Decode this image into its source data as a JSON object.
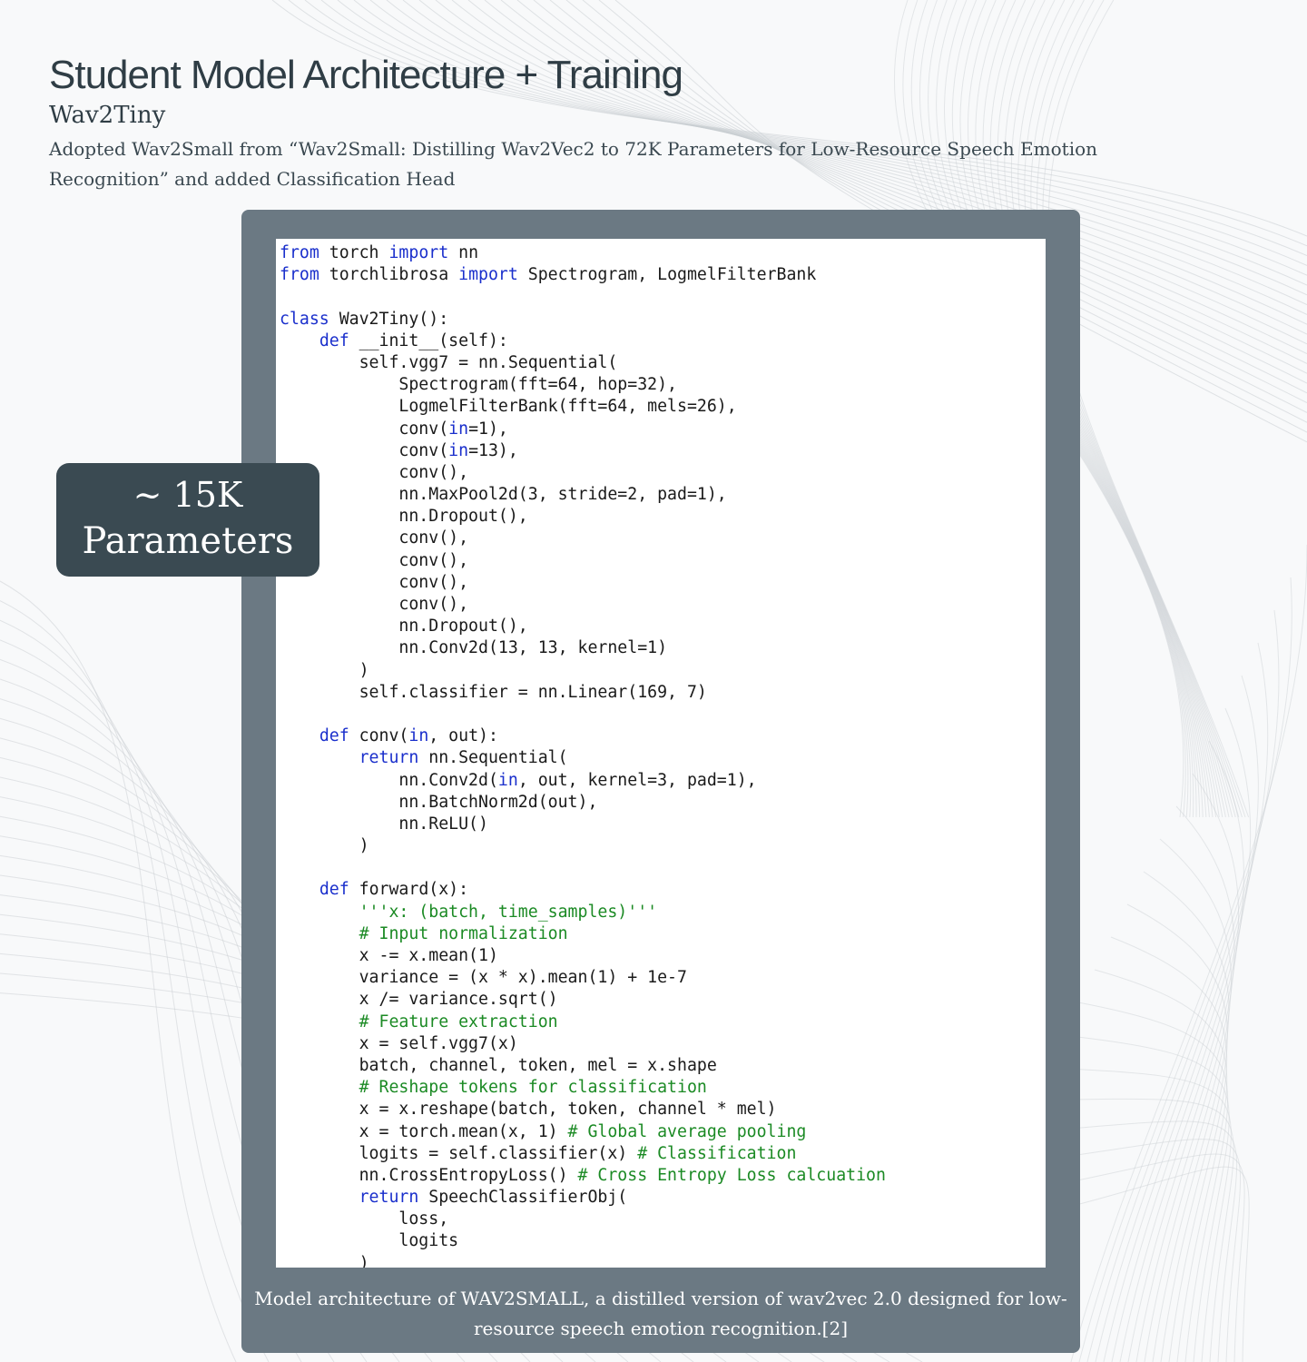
{
  "header": {
    "title": "Student Model Architecture + Training",
    "subtitle": "Wav2Tiny",
    "description": "Adopted Wav2Small from “Wav2Small: Distilling Wav2Vec2 to 72K Parameters for Low-Resource Speech Emotion Recognition” and added Classification Head"
  },
  "badge": {
    "line1": "~ 15K",
    "line2": "Parameters"
  },
  "code_figure": {
    "lines": [
      [
        [
          "kw",
          "from"
        ],
        [
          "t",
          " torch "
        ],
        [
          "kw",
          "import"
        ],
        [
          "t",
          " nn"
        ]
      ],
      [
        [
          "kw",
          "from"
        ],
        [
          "t",
          " torchlibrosa "
        ],
        [
          "kw",
          "import"
        ],
        [
          "t",
          " Spectrogram, LogmelFilterBank"
        ]
      ],
      [
        [
          "t",
          ""
        ]
      ],
      [
        [
          "kw",
          "class"
        ],
        [
          "t",
          " Wav2Tiny():"
        ]
      ],
      [
        [
          "t",
          "    "
        ],
        [
          "kw",
          "def"
        ],
        [
          "t",
          " __init__(self):"
        ]
      ],
      [
        [
          "t",
          "        self.vgg7 = nn.Sequential("
        ]
      ],
      [
        [
          "t",
          "            Spectrogram(fft=64, hop=32),"
        ]
      ],
      [
        [
          "t",
          "            LogmelFilterBank(fft=64, mels=26),"
        ]
      ],
      [
        [
          "t",
          "            conv("
        ],
        [
          "kw",
          "in"
        ],
        [
          "t",
          "=1),"
        ]
      ],
      [
        [
          "t",
          "            conv("
        ],
        [
          "kw",
          "in"
        ],
        [
          "t",
          "=13),"
        ]
      ],
      [
        [
          "t",
          "            conv(),"
        ]
      ],
      [
        [
          "t",
          "            nn.MaxPool2d(3, stride=2, pad=1),"
        ]
      ],
      [
        [
          "t",
          "            nn.Dropout(),"
        ]
      ],
      [
        [
          "t",
          "            conv(),"
        ]
      ],
      [
        [
          "t",
          "            conv(),"
        ]
      ],
      [
        [
          "t",
          "            conv(),"
        ]
      ],
      [
        [
          "t",
          "            conv(),"
        ]
      ],
      [
        [
          "t",
          "            nn.Dropout(),"
        ]
      ],
      [
        [
          "t",
          "            nn.Conv2d(13, 13, kernel=1)"
        ]
      ],
      [
        [
          "t",
          "        )"
        ]
      ],
      [
        [
          "t",
          "        self.classifier = nn.Linear(169, 7)"
        ]
      ],
      [
        [
          "t",
          ""
        ]
      ],
      [
        [
          "t",
          "    "
        ],
        [
          "kw",
          "def"
        ],
        [
          "t",
          " conv("
        ],
        [
          "kw",
          "in"
        ],
        [
          "t",
          ", out):"
        ]
      ],
      [
        [
          "t",
          "        "
        ],
        [
          "kw",
          "return"
        ],
        [
          "t",
          " nn.Sequential("
        ]
      ],
      [
        [
          "t",
          "            nn.Conv2d("
        ],
        [
          "kw",
          "in"
        ],
        [
          "t",
          ", out, kernel=3, pad=1),"
        ]
      ],
      [
        [
          "t",
          "            nn.BatchNorm2d(out),"
        ]
      ],
      [
        [
          "t",
          "            nn.ReLU()"
        ]
      ],
      [
        [
          "t",
          "        )"
        ]
      ],
      [
        [
          "t",
          ""
        ]
      ],
      [
        [
          "t",
          "    "
        ],
        [
          "kw",
          "def"
        ],
        [
          "t",
          " forward(x):"
        ]
      ],
      [
        [
          "t",
          "        "
        ],
        [
          "cm",
          "'''x: (batch, time_samples)'''"
        ]
      ],
      [
        [
          "t",
          "        "
        ],
        [
          "cm",
          "# Input normalization"
        ]
      ],
      [
        [
          "t",
          "        x -= x.mean(1)"
        ]
      ],
      [
        [
          "t",
          "        variance = (x * x).mean(1) + 1e-7"
        ]
      ],
      [
        [
          "t",
          "        x /= variance.sqrt()"
        ]
      ],
      [
        [
          "t",
          "        "
        ],
        [
          "cm",
          "# Feature extraction"
        ]
      ],
      [
        [
          "t",
          "        x = self.vgg7(x)"
        ]
      ],
      [
        [
          "t",
          "        batch, channel, token, mel = x.shape"
        ]
      ],
      [
        [
          "t",
          "        "
        ],
        [
          "cm",
          "# Reshape tokens for classification"
        ]
      ],
      [
        [
          "t",
          "        x = x.reshape(batch, token, channel * mel)"
        ]
      ],
      [
        [
          "t",
          "        x = torch.mean(x, 1) "
        ],
        [
          "cm",
          "# Global average pooling"
        ]
      ],
      [
        [
          "t",
          "        logits = self.classifier(x) "
        ],
        [
          "cm",
          "# Classification"
        ]
      ],
      [
        [
          "t",
          "        nn.CrossEntropyLoss() "
        ],
        [
          "cm",
          "# Cross Entropy Loss calcuation"
        ]
      ],
      [
        [
          "t",
          "        "
        ],
        [
          "kw",
          "return"
        ],
        [
          "t",
          " SpeechClassifierObj("
        ]
      ],
      [
        [
          "t",
          "            loss,"
        ]
      ],
      [
        [
          "t",
          "            logits"
        ]
      ],
      [
        [
          "t",
          "        )"
        ]
      ]
    ],
    "caption": "Model architecture of WAV2SMALL, a distilled version of wav2vec 2.0 designed for low-resource speech emotion recognition.[2]"
  },
  "colors": {
    "keyword": "#1a2fcc",
    "comment": "#1b8a24",
    "panel": "#6b7983",
    "badge": "#3a4a52",
    "title": "#2f3d45"
  }
}
